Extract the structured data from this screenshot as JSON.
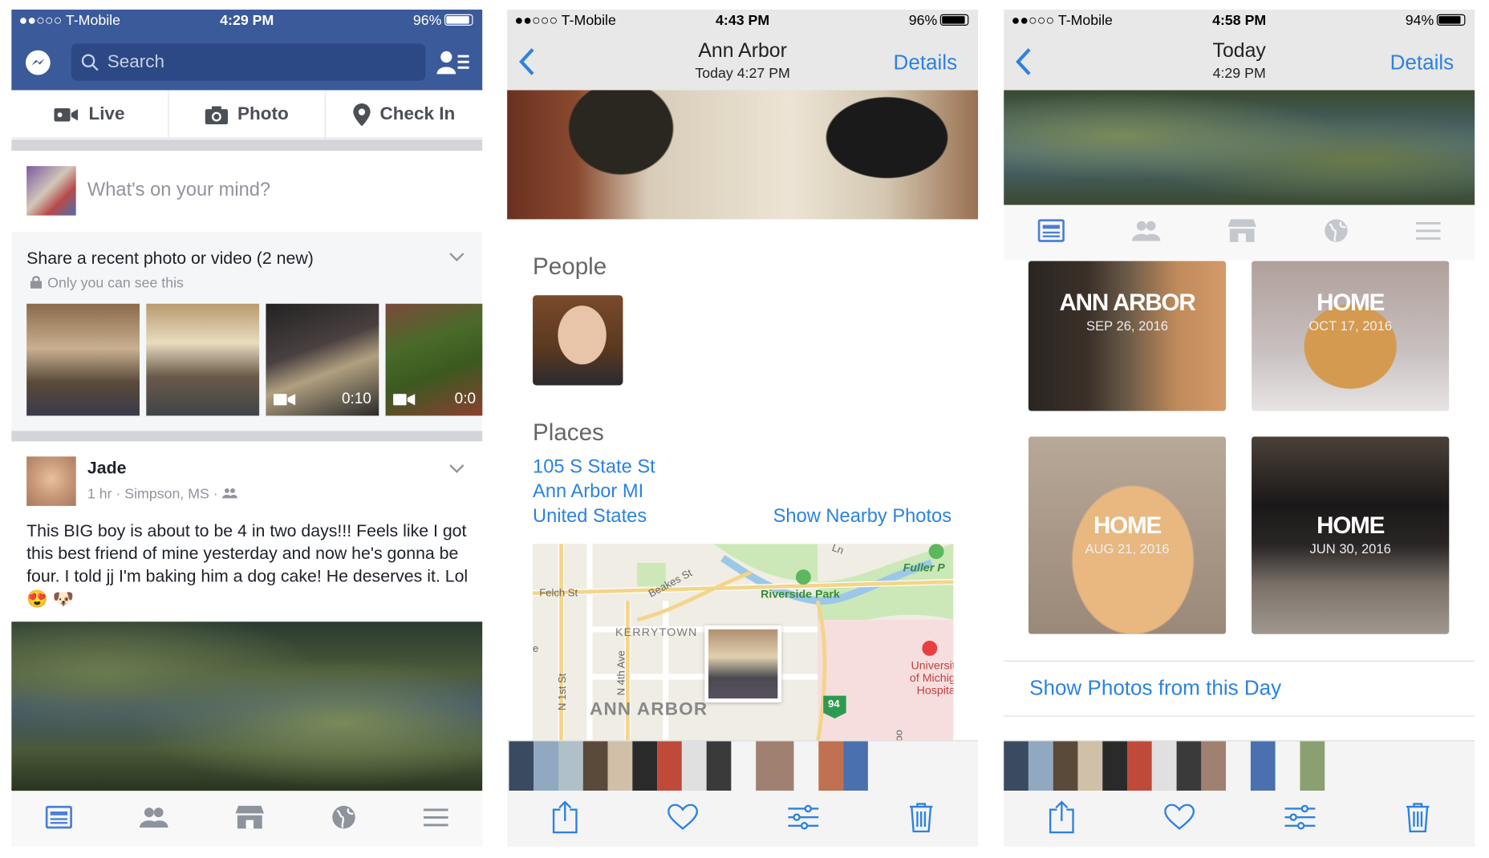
{
  "colors": {
    "fb_blue": "#3b5a9a",
    "ios_link": "#2d82e0",
    "icon_grey": "#8d949e"
  },
  "p1": {
    "status": {
      "carrier": "●●○○○ T-Mobile",
      "time": "4:29 PM",
      "battery": "96%"
    },
    "search_placeholder": "Search",
    "actions": [
      "Live",
      "Photo",
      "Check In"
    ],
    "composer_placeholder": "What's on your mind?",
    "share": {
      "title": "Share a recent photo or video (2 new)",
      "privacy": "Only you can see this",
      "durations": [
        "0:10",
        "0:0"
      ]
    },
    "post": {
      "author": "Jade",
      "meta": "1 hr · Simpson, MS ·",
      "text": "This BIG boy is about to be 4 in two days!!! Feels like I got this best friend of mine yesterday and now he's gonna be four. I told jj I'm baking him a dog cake! He deserves it. Lol 😍 🐶"
    },
    "tabs": [
      "news-feed-icon",
      "friends-icon",
      "marketplace-icon",
      "globe-icon",
      "menu-icon"
    ]
  },
  "p2": {
    "status": {
      "carrier": "●●○○○ T-Mobile",
      "time": "4:43 PM",
      "battery": "96%"
    },
    "title": "Ann Arbor",
    "subtitle": "Today  4:27 PM",
    "details": "Details",
    "people_heading": "People",
    "places_heading": "Places",
    "address": [
      "105 S State St",
      "Ann Arbor MI",
      "United States"
    ],
    "nearby": "Show Nearby Photos",
    "map_labels": {
      "felch": "Felch St",
      "beakes": "Beakes St",
      "riverside": "Riverside Park",
      "kerrytown": "KERRYTOWN",
      "annarbor": "ANN ARBOR",
      "fuller": "Fuller P",
      "ln": "Ln",
      "fourth": "N 4th Ave",
      "first": "N 1st St",
      "hospital": "Universit of Michig Hospita",
      "hwy": "94",
      "go": "oo",
      "e": "e"
    }
  },
  "p3": {
    "status": {
      "carrier": "●●○○○ T-Mobile",
      "time": "4:58 PM",
      "battery": "94%"
    },
    "title": "Today",
    "subtitle": "4:29 PM",
    "details": "Details",
    "memories": [
      {
        "place": "ANN ARBOR",
        "date": "SEP 26, 2016"
      },
      {
        "place": "HOME",
        "date": "OCT 17, 2016"
      },
      {
        "place": "HOME",
        "date": "AUG 21, 2016"
      },
      {
        "place": "HOME",
        "date": "JUN 30, 2016"
      }
    ],
    "show_day": "Show Photos from this Day"
  }
}
